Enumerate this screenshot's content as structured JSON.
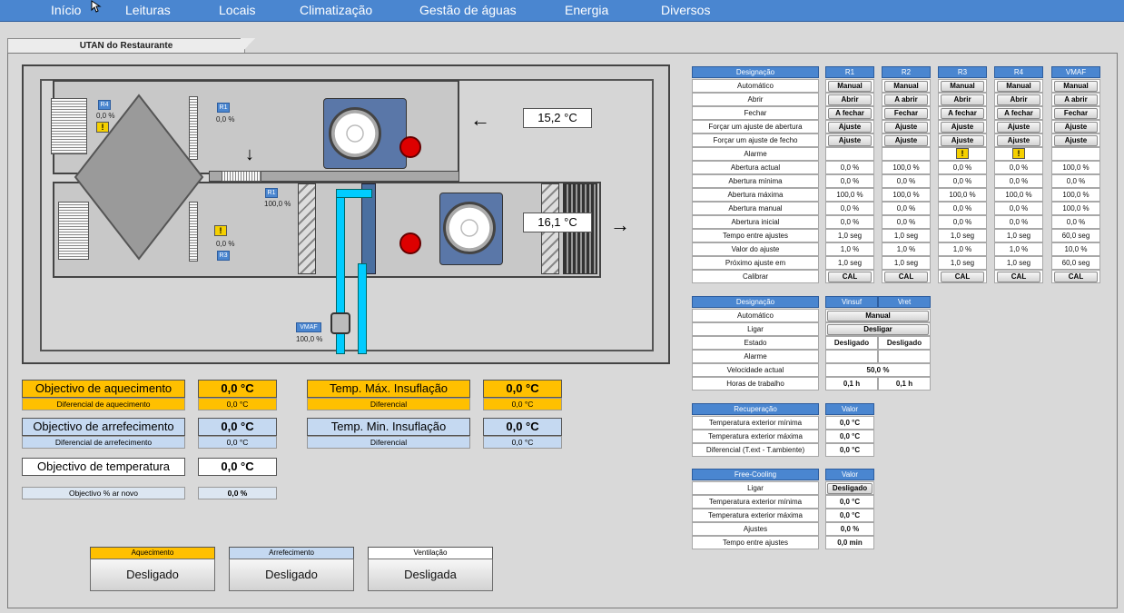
{
  "nav": {
    "items": [
      "Início",
      "Leituras",
      "Locais",
      "Climatização",
      "Gestão de águas",
      "Energia",
      "Diversos"
    ]
  },
  "tab": {
    "title": "UTAN do Restaurante"
  },
  "diagram": {
    "temp_top": "15,2 °C",
    "temp_bottom": "16,1 °C",
    "arrow_left": "←",
    "arrow_right": "→",
    "arrow_down": "↓",
    "r4": {
      "label": "R4",
      "value": "0,0 %"
    },
    "r1_top": {
      "label": "R1",
      "value": "0,0 %"
    },
    "r1_mid": {
      "label": "R1",
      "value": "100,0 %"
    },
    "r3": {
      "label": "R3",
      "value": "0,0 %"
    },
    "vmaf": {
      "label": "VMAF",
      "value": "100,0 %"
    }
  },
  "setpoints": {
    "heating": {
      "label": "Objectivo de aquecimento",
      "value": "0,0 °C",
      "sub_label": "Diferencial de aquecimento",
      "sub_value": "0,0 °C",
      "color": "#ffc000"
    },
    "max_supply": {
      "label": "Temp. Máx. Insuflação",
      "value": "0,0 °C",
      "sub_label": "Diferencial",
      "sub_value": "0,0 °C"
    },
    "cooling": {
      "label": "Objectivo de arrefecimento",
      "value": "0,0 °C",
      "sub_label": "Diferencial de arrefecimento",
      "sub_value": "0,0 °C",
      "color": "#c5d9f1"
    },
    "min_supply": {
      "label": "Temp. Min. Insuflação",
      "value": "0,0 °C",
      "sub_label": "Diferencial",
      "sub_value": "0,0 °C"
    },
    "temperature": {
      "label": "Objectivo de temperatura",
      "value": "0,0 °C"
    },
    "fresh_air": {
      "label": "Objectivo % ar novo",
      "value": "0,0 %"
    }
  },
  "modes": {
    "heating": {
      "title": "Aquecimento",
      "state": "Desligado",
      "color": "#ffc000"
    },
    "cooling": {
      "title": "Arrefecimento",
      "state": "Desligado",
      "color": "#c5d9f1"
    },
    "ventilation": {
      "title": "Ventilação",
      "state": "Desligada",
      "color": "#ffffff"
    }
  },
  "dampers": {
    "designation_header": "Designação",
    "row_labels": [
      "Automático",
      "Abrir",
      "Fechar",
      "Forçar um ajuste de abertura",
      "Forçar um ajuste de fecho",
      "Alarme",
      "Abertura actual",
      "Abertura mínima",
      "Abertura máxima",
      "Abertura manual",
      "Abertura inicial",
      "Tempo entre ajustes",
      "Valor do ajuste",
      "Próximo ajuste em",
      "Calibrar"
    ],
    "columns": [
      {
        "name": "R1",
        "automatico": "Manual",
        "abrir": "Abrir",
        "fechar": "A fechar",
        "forcar_abertura": "Ajuste",
        "forcar_fecho": "Ajuste",
        "alarme": "",
        "actual": "0,0 %",
        "minima": "0,0 %",
        "maxima": "100,0 %",
        "manual": "0,0 %",
        "inicial": "0,0 %",
        "tempo": "1,0 seg",
        "valor": "1,0 %",
        "proximo": "1,0 seg",
        "calibrar": "CAL"
      },
      {
        "name": "R2",
        "automatico": "Manual",
        "abrir": "A abrir",
        "fechar": "Fechar",
        "forcar_abertura": "Ajuste",
        "forcar_fecho": "Ajuste",
        "alarme": "",
        "actual": "100,0 %",
        "minima": "0,0 %",
        "maxima": "100,0 %",
        "manual": "0,0 %",
        "inicial": "0,0 %",
        "tempo": "1,0 seg",
        "valor": "1,0 %",
        "proximo": "1,0 seg",
        "calibrar": "CAL"
      },
      {
        "name": "R3",
        "automatico": "Manual",
        "abrir": "Abrir",
        "fechar": "A fechar",
        "forcar_abertura": "Ajuste",
        "forcar_fecho": "Ajuste",
        "alarme": "warning",
        "actual": "0,0 %",
        "minima": "0,0 %",
        "maxima": "100,0 %",
        "manual": "0,0 %",
        "inicial": "0,0 %",
        "tempo": "1,0 seg",
        "valor": "1,0 %",
        "proximo": "1,0 seg",
        "calibrar": "CAL"
      },
      {
        "name": "R4",
        "automatico": "Manual",
        "abrir": "Abrir",
        "fechar": "A fechar",
        "forcar_abertura": "Ajuste",
        "forcar_fecho": "Ajuste",
        "alarme": "warning",
        "actual": "0,0 %",
        "minima": "0,0 %",
        "maxima": "100,0 %",
        "manual": "0,0 %",
        "inicial": "0,0 %",
        "tempo": "1,0 seg",
        "valor": "1,0 %",
        "proximo": "1,0 seg",
        "calibrar": "CAL"
      },
      {
        "name": "VMAF",
        "automatico": "Manual",
        "abrir": "A abrir",
        "fechar": "Fechar",
        "forcar_abertura": "Ajuste",
        "forcar_fecho": "Ajuste",
        "alarme": "",
        "actual": "100,0 %",
        "minima": "0,0 %",
        "maxima": "100,0 %",
        "manual": "100,0 %",
        "inicial": "0,0 %",
        "tempo": "60,0 seg",
        "valor": "10,0 %",
        "proximo": "60,0 seg",
        "calibrar": "CAL"
      }
    ]
  },
  "fans": {
    "designation_header": "Designação",
    "col1": "Vinsuf",
    "col2": "Vret",
    "rows": {
      "automatico": "Automático",
      "ligar": "Ligar",
      "estado": "Estado",
      "alarme": "Alarme",
      "velocidade": "Velocidade actual",
      "horas": "Horas de trabalho"
    },
    "automatico_btn": "Manual",
    "ligar_btn": "Desligar",
    "estado1": "Desligado",
    "estado2": "Desligado",
    "velocidade": "50,0 %",
    "horas1": "0,1 h",
    "horas2": "0,1 h"
  },
  "recovery": {
    "header": "Recuperação",
    "value_header": "Valor",
    "rows": [
      {
        "label": "Temperatura exterior mínima",
        "value": "0,0 °C"
      },
      {
        "label": "Temperatura exterior máxima",
        "value": "0,0 °C"
      },
      {
        "label": "Diferencial (T.ext - T.ambiente)",
        "value": "0,0 °C"
      }
    ]
  },
  "freecooling": {
    "header": "Free-Cooling",
    "value_header": "Valor",
    "ligar_label": "Ligar",
    "ligar_btn": "Desligado",
    "rows": [
      {
        "label": "Temperatura exterior mínima",
        "value": "0,0 °C"
      },
      {
        "label": "Temperatura exterior máxima",
        "value": "0,0 °C"
      },
      {
        "label": "Ajustes",
        "value": "0,0 %"
      },
      {
        "label": "Tempo entre ajustes",
        "value": "0,0 min"
      }
    ]
  },
  "colors": {
    "nav": "#4a86d0",
    "header": "#4a86d0",
    "heating": "#ffc000",
    "cooling": "#c5d9f1",
    "pipe": "#00ccff"
  }
}
